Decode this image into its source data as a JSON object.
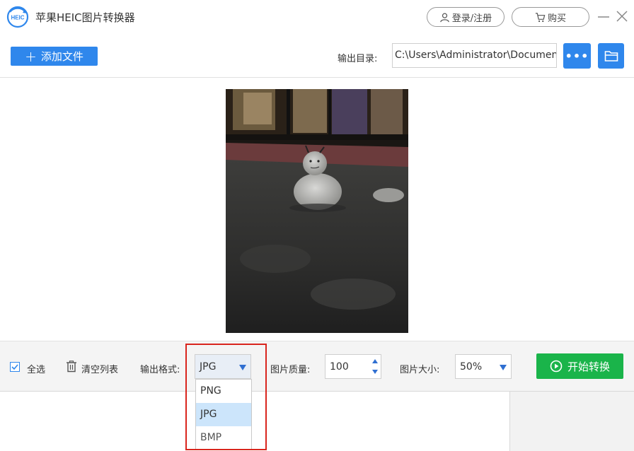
{
  "app": {
    "title": "苹果HEIC图片转换器",
    "logo_text": "HEIC",
    "login_label": "登录/注册",
    "buy_label": "购买"
  },
  "toolbar": {
    "add_file_label": "添加文件",
    "output_dir_label": "输出目录:",
    "output_dir_value": "C:\\Users\\Administrator\\Documents",
    "more_label": "•••"
  },
  "controls": {
    "select_all_label": "全选",
    "select_all_checked": true,
    "clear_list_label": "清空列表",
    "format_label": "输出格式:",
    "format_value": "JPG",
    "quality_label": "图片质量:",
    "quality_value": "100",
    "size_label": "图片大小:",
    "size_value": "50%",
    "start_label": "开始转换"
  },
  "format_dropdown": {
    "options": [
      "PNG",
      "JPG",
      "BMP"
    ],
    "selected": "JPG"
  },
  "colors": {
    "accent_blue": "#2f87ec",
    "start_green": "#1ab44a",
    "highlight_red": "#d9251d",
    "dropdown_selected": "#cce5fb"
  }
}
